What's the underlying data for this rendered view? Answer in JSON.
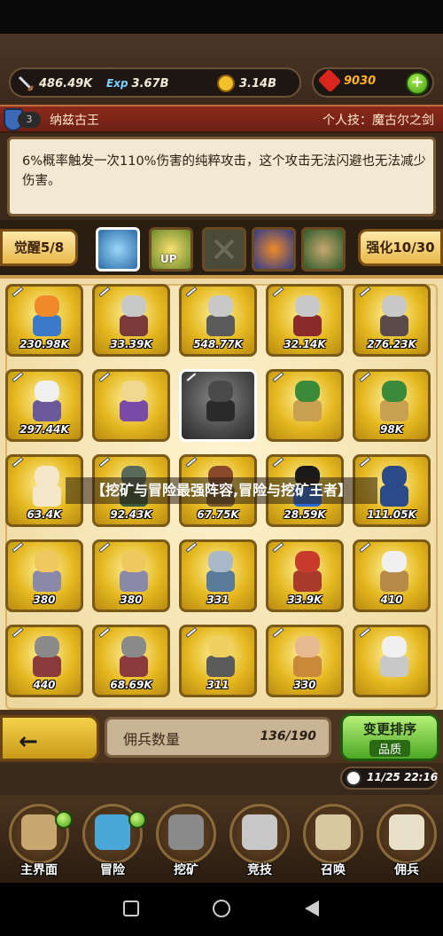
{
  "currencies": {
    "attack": "486.49K",
    "exp_label": "Exp",
    "exp": "3.67B",
    "gold": "3.14B",
    "gems": "9030"
  },
  "hero": {
    "level": "3",
    "name": "纳兹古王",
    "skill_label": "个人技：魔古尔之剑",
    "description": "6%概率触发一次110%伤害的纯粹攻击，这个攻击无法闪避也无法减少伤害。"
  },
  "tabs": {
    "awaken": "觉醒5/8",
    "enhance": "强化10/30",
    "upgrade_badge": "UP"
  },
  "grid": [
    {
      "value": "230.98K",
      "head": "#f08a2a",
      "body": "#3a7ac8"
    },
    {
      "value": "33.39K",
      "head": "#c8c8c8",
      "body": "#7a3a3a"
    },
    {
      "value": "548.77K",
      "head": "#c8c8c8",
      "body": "#5a5a5a"
    },
    {
      "value": "32.14K",
      "head": "#c8c8c8",
      "body": "#8a2a2a"
    },
    {
      "value": "276.23K",
      "head": "#c8c8c8",
      "body": "#5a4a4a"
    },
    {
      "value": "297.44K",
      "head": "#f0f0f0",
      "body": "#6a5a9a"
    },
    {
      "value": "",
      "head": "#f0d890",
      "body": "#7a4aa8"
    },
    {
      "value": "",
      "head": "#4a4a4a",
      "body": "#2a2a2a"
    },
    {
      "value": "",
      "head": "#3a8a3a",
      "body": "#c8a050"
    },
    {
      "value": "98K",
      "head": "#3a8a3a",
      "body": "#c8a050"
    },
    {
      "value": "63.4K",
      "head": "#f4e8c8",
      "body": "#f4e8c8"
    },
    {
      "value": "92.43K",
      "head": "#5a6a5a",
      "body": "#3a5a3a"
    },
    {
      "value": "67.75K",
      "head": "#8a4a2a",
      "body": "#7a5a2a"
    },
    {
      "value": "28.59K",
      "head": "#1a1a1a",
      "body": "#2a6ad8"
    },
    {
      "value": "111.05K",
      "head": "#2a4a8a",
      "body": "#2a4a8a"
    },
    {
      "value": "380",
      "head": "#f0c860",
      "body": "#8a8aa8"
    },
    {
      "value": "380",
      "head": "#f0c860",
      "body": "#8a8aa8"
    },
    {
      "value": "331",
      "head": "#a8b8c8",
      "body": "#5a7a9a"
    },
    {
      "value": "33.9K",
      "head": "#c83a2a",
      "body": "#a83a2a"
    },
    {
      "value": "410",
      "head": "#f0f0f0",
      "body": "#b88a4a"
    },
    {
      "value": "440",
      "head": "#8a8a8a",
      "body": "#8a3a3a"
    },
    {
      "value": "68.69K",
      "head": "#8a8a8a",
      "body": "#8a3a3a"
    },
    {
      "value": "311",
      "head": "#f0d060",
      "body": "#5a5a5a"
    },
    {
      "value": "330",
      "head": "#e8b890",
      "body": "#c88a3a"
    },
    {
      "value": "",
      "head": "#f0f0f0",
      "body": "#c8c8c8"
    }
  ],
  "overlay_title": "【挖矿与冒险最强阵容,冒险与挖矿王者】",
  "mercenary": {
    "label": "佣兵数量",
    "count": "136/190"
  },
  "sort_button": {
    "title": "变更排序",
    "subtitle": "品质"
  },
  "clock": "11/25 22:16",
  "nav": [
    {
      "label": "主界面",
      "color": "#c8a870",
      "dot": true
    },
    {
      "label": "冒险",
      "color": "#4aa8d8",
      "dot": true
    },
    {
      "label": "挖矿",
      "color": "#8a8a8a",
      "dot": false
    },
    {
      "label": "竞技",
      "color": "#c8c8c8",
      "dot": false
    },
    {
      "label": "召唤",
      "color": "#d8c8a0",
      "dot": false
    },
    {
      "label": "佣兵",
      "color": "#e8e0c8",
      "dot": false
    }
  ]
}
